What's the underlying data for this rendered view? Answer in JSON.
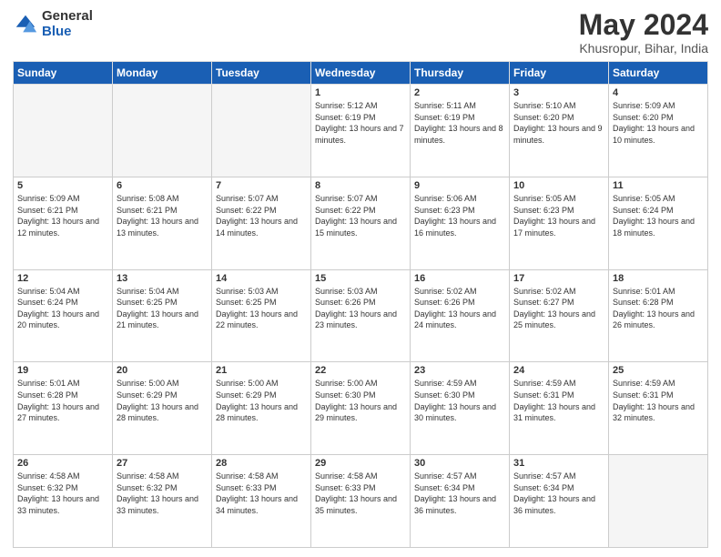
{
  "header": {
    "logo_general": "General",
    "logo_blue": "Blue",
    "month_title": "May 2024",
    "location": "Khusropur, Bihar, India"
  },
  "weekdays": [
    "Sunday",
    "Monday",
    "Tuesday",
    "Wednesday",
    "Thursday",
    "Friday",
    "Saturday"
  ],
  "weeks": [
    [
      {
        "num": "",
        "empty": true
      },
      {
        "num": "",
        "empty": true
      },
      {
        "num": "",
        "empty": true
      },
      {
        "num": "1",
        "sunrise": "5:12 AM",
        "sunset": "6:19 PM",
        "daylight": "13 hours and 7 minutes."
      },
      {
        "num": "2",
        "sunrise": "5:11 AM",
        "sunset": "6:19 PM",
        "daylight": "13 hours and 8 minutes."
      },
      {
        "num": "3",
        "sunrise": "5:10 AM",
        "sunset": "6:20 PM",
        "daylight": "13 hours and 9 minutes."
      },
      {
        "num": "4",
        "sunrise": "5:09 AM",
        "sunset": "6:20 PM",
        "daylight": "13 hours and 10 minutes."
      }
    ],
    [
      {
        "num": "5",
        "sunrise": "5:09 AM",
        "sunset": "6:21 PM",
        "daylight": "13 hours and 12 minutes."
      },
      {
        "num": "6",
        "sunrise": "5:08 AM",
        "sunset": "6:21 PM",
        "daylight": "13 hours and 13 minutes."
      },
      {
        "num": "7",
        "sunrise": "5:07 AM",
        "sunset": "6:22 PM",
        "daylight": "13 hours and 14 minutes."
      },
      {
        "num": "8",
        "sunrise": "5:07 AM",
        "sunset": "6:22 PM",
        "daylight": "13 hours and 15 minutes."
      },
      {
        "num": "9",
        "sunrise": "5:06 AM",
        "sunset": "6:23 PM",
        "daylight": "13 hours and 16 minutes."
      },
      {
        "num": "10",
        "sunrise": "5:05 AM",
        "sunset": "6:23 PM",
        "daylight": "13 hours and 17 minutes."
      },
      {
        "num": "11",
        "sunrise": "5:05 AM",
        "sunset": "6:24 PM",
        "daylight": "13 hours and 18 minutes."
      }
    ],
    [
      {
        "num": "12",
        "sunrise": "5:04 AM",
        "sunset": "6:24 PM",
        "daylight": "13 hours and 20 minutes."
      },
      {
        "num": "13",
        "sunrise": "5:04 AM",
        "sunset": "6:25 PM",
        "daylight": "13 hours and 21 minutes."
      },
      {
        "num": "14",
        "sunrise": "5:03 AM",
        "sunset": "6:25 PM",
        "daylight": "13 hours and 22 minutes."
      },
      {
        "num": "15",
        "sunrise": "5:03 AM",
        "sunset": "6:26 PM",
        "daylight": "13 hours and 23 minutes."
      },
      {
        "num": "16",
        "sunrise": "5:02 AM",
        "sunset": "6:26 PM",
        "daylight": "13 hours and 24 minutes."
      },
      {
        "num": "17",
        "sunrise": "5:02 AM",
        "sunset": "6:27 PM",
        "daylight": "13 hours and 25 minutes."
      },
      {
        "num": "18",
        "sunrise": "5:01 AM",
        "sunset": "6:28 PM",
        "daylight": "13 hours and 26 minutes."
      }
    ],
    [
      {
        "num": "19",
        "sunrise": "5:01 AM",
        "sunset": "6:28 PM",
        "daylight": "13 hours and 27 minutes."
      },
      {
        "num": "20",
        "sunrise": "5:00 AM",
        "sunset": "6:29 PM",
        "daylight": "13 hours and 28 minutes."
      },
      {
        "num": "21",
        "sunrise": "5:00 AM",
        "sunset": "6:29 PM",
        "daylight": "13 hours and 28 minutes."
      },
      {
        "num": "22",
        "sunrise": "5:00 AM",
        "sunset": "6:30 PM",
        "daylight": "13 hours and 29 minutes."
      },
      {
        "num": "23",
        "sunrise": "4:59 AM",
        "sunset": "6:30 PM",
        "daylight": "13 hours and 30 minutes."
      },
      {
        "num": "24",
        "sunrise": "4:59 AM",
        "sunset": "6:31 PM",
        "daylight": "13 hours and 31 minutes."
      },
      {
        "num": "25",
        "sunrise": "4:59 AM",
        "sunset": "6:31 PM",
        "daylight": "13 hours and 32 minutes."
      }
    ],
    [
      {
        "num": "26",
        "sunrise": "4:58 AM",
        "sunset": "6:32 PM",
        "daylight": "13 hours and 33 minutes."
      },
      {
        "num": "27",
        "sunrise": "4:58 AM",
        "sunset": "6:32 PM",
        "daylight": "13 hours and 33 minutes."
      },
      {
        "num": "28",
        "sunrise": "4:58 AM",
        "sunset": "6:33 PM",
        "daylight": "13 hours and 34 minutes."
      },
      {
        "num": "29",
        "sunrise": "4:58 AM",
        "sunset": "6:33 PM",
        "daylight": "13 hours and 35 minutes."
      },
      {
        "num": "30",
        "sunrise": "4:57 AM",
        "sunset": "6:34 PM",
        "daylight": "13 hours and 36 minutes."
      },
      {
        "num": "31",
        "sunrise": "4:57 AM",
        "sunset": "6:34 PM",
        "daylight": "13 hours and 36 minutes."
      },
      {
        "num": "",
        "empty": true
      }
    ]
  ]
}
